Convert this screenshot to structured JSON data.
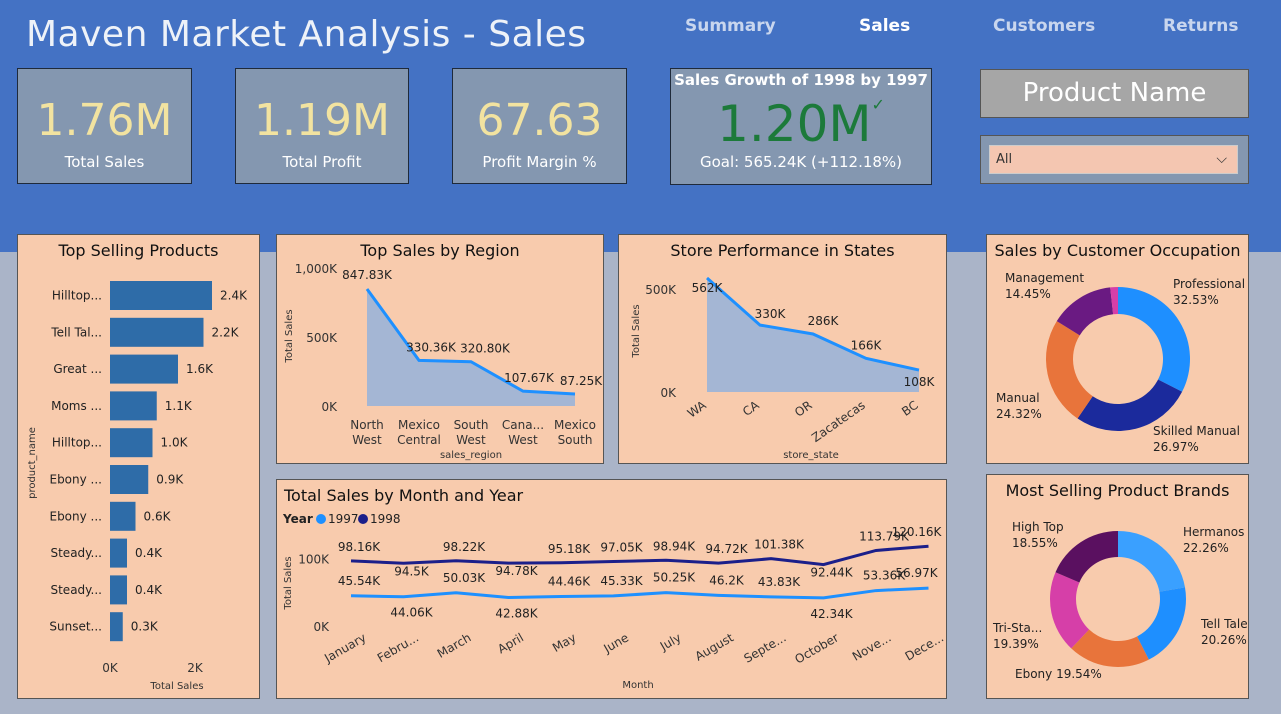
{
  "header": {
    "title": "Maven Market Analysis - Sales",
    "nav": [
      "Summary",
      "Sales",
      "Customers",
      "Returns"
    ]
  },
  "kpis": [
    {
      "value": "1.76M",
      "label": "Total Sales"
    },
    {
      "value": "1.19M",
      "label": "Total Profit"
    },
    {
      "value": "67.63",
      "label": "Profit Margin %"
    }
  ],
  "growth": {
    "title": "Sales Growth of 1998 by 1997",
    "value": "1.20M",
    "goal": "Goal: 565.24K (+112.18%)",
    "check": "✓"
  },
  "product_name": {
    "label": "Product Name",
    "selected": "All",
    "chevron": "⌵"
  },
  "colors": {
    "header_bg": "#4472c4",
    "panel_bg": "#f8cbad",
    "bar": "#2e6ca8",
    "line1997": "#1e90ff",
    "line1998": "#1b1f8a"
  },
  "chart_data": [
    {
      "type": "bar",
      "title": "Top Selling Products",
      "xlabel": "Total Sales",
      "ylabel": "product_name",
      "categories": [
        "Hilltop...",
        "Tell Tal...",
        "Great ...",
        "Moms ...",
        "Hilltop...",
        "Ebony ...",
        "Ebony ...",
        "Steady...",
        "Steady...",
        "Sunset..."
      ],
      "values": [
        2.4,
        2.2,
        1.6,
        1.1,
        1.0,
        0.9,
        0.6,
        0.4,
        0.4,
        0.3
      ],
      "labels": [
        "2.4K",
        "2.2K",
        "1.6K",
        "1.1K",
        "1.0K",
        "0.9K",
        "0.6K",
        "0.4K",
        "0.4K",
        "0.3K"
      ],
      "xticks": [
        "0K",
        "2K"
      ],
      "xlim": [
        0,
        2.4
      ]
    },
    {
      "type": "area",
      "title": "Top Sales by Region",
      "xlabel": "sales_region",
      "ylabel": "Total Sales",
      "categories": [
        [
          "North",
          "West"
        ],
        [
          "Mexico",
          "Central"
        ],
        [
          "South",
          "West"
        ],
        [
          "Cana...",
          "West"
        ],
        [
          "Mexico",
          "South"
        ]
      ],
      "values": [
        847.83,
        330.36,
        320.8,
        107.67,
        87.25
      ],
      "labels": [
        "847.83K",
        "330.36K",
        "320.80K",
        "107.67K",
        "87.25K"
      ],
      "yticks": [
        "1,000K",
        "500K",
        "0K"
      ],
      "ylim": [
        0,
        1000
      ]
    },
    {
      "type": "area",
      "title": "Store Performance in States",
      "xlabel": "store_state",
      "ylabel": "Total Sales",
      "categories": [
        "WA",
        "CA",
        "OR",
        "Zacatecas",
        "BC"
      ],
      "values": [
        562,
        330,
        286,
        166,
        108
      ],
      "labels": [
        "562K",
        "330K",
        "286K",
        "166K",
        "108K"
      ],
      "yticks": [
        "500K",
        "0K"
      ],
      "ylim": [
        0,
        562
      ]
    },
    {
      "type": "pie",
      "title": "Sales by Customer Occupation",
      "slices": [
        {
          "name": "Professional",
          "pct": "32.53%",
          "value": 32.53,
          "color": "#1e8fff"
        },
        {
          "name": "Skilled Manual",
          "pct": "26.97%",
          "value": 26.97,
          "color": "#1b2a9c"
        },
        {
          "name": "Manual",
          "pct": "24.32%",
          "value": 24.32,
          "color": "#e8743b"
        },
        {
          "name": "Management",
          "pct": "14.45%",
          "value": 14.45,
          "color": "#6a1a82"
        },
        {
          "name": "",
          "pct": "",
          "value": 1.73,
          "color": "#d63fa8"
        }
      ]
    },
    {
      "type": "line",
      "title": "Total Sales by Month and Year",
      "legend_title": "Year",
      "xlabel": "Month",
      "ylabel": "Total Sales",
      "categories": [
        "January",
        "Febru...",
        "March",
        "April",
        "May",
        "June",
        "July",
        "August",
        "Septe...",
        "October",
        "Nove...",
        "Dece..."
      ],
      "yticks": [
        "100K",
        "0K"
      ],
      "ylim": [
        0,
        125
      ],
      "series": [
        {
          "name": "1997",
          "color": "#1e90ff",
          "values": [
            45.54,
            44.06,
            50.03,
            42.88,
            44.46,
            45.33,
            50.25,
            46.2,
            43.83,
            42.34,
            53.36,
            56.97
          ],
          "labels": [
            "45.54K",
            "44.06K",
            "50.03K",
            "42.88K",
            "44.46K",
            "45.33K",
            "50.25K",
            "46.2K",
            "43.83K",
            "42.34K",
            "53.36K",
            "56.97K"
          ]
        },
        {
          "name": "1998",
          "color": "#1b1f8a",
          "values": [
            98.16,
            94.5,
            98.22,
            94.78,
            95.18,
            97.05,
            98.94,
            94.72,
            101.38,
            92.44,
            113.79,
            120.16
          ],
          "labels": [
            "98.16K",
            "94.5K",
            "98.22K",
            "94.78K",
            "95.18K",
            "97.05K",
            "98.94K",
            "94.72K",
            "101.38K",
            "92.44K",
            "113.79K",
            "120.16K"
          ]
        }
      ]
    },
    {
      "type": "pie",
      "title": "Most Selling Product Brands",
      "slices": [
        {
          "name": "Hermanos",
          "pct": "22.26%",
          "value": 22.26,
          "color": "#3aa0ff"
        },
        {
          "name": "Tell Tale",
          "pct": "20.26%",
          "value": 20.26,
          "color": "#1e8fff"
        },
        {
          "name": "Ebony",
          "pct": "19.54%",
          "value": 19.54,
          "color": "#e8743b"
        },
        {
          "name": "Tri-Sta...",
          "pct": "19.39%",
          "value": 19.39,
          "color": "#d63fa8"
        },
        {
          "name": "High Top",
          "pct": "18.55%",
          "value": 18.55,
          "color": "#5a1060"
        }
      ]
    }
  ]
}
